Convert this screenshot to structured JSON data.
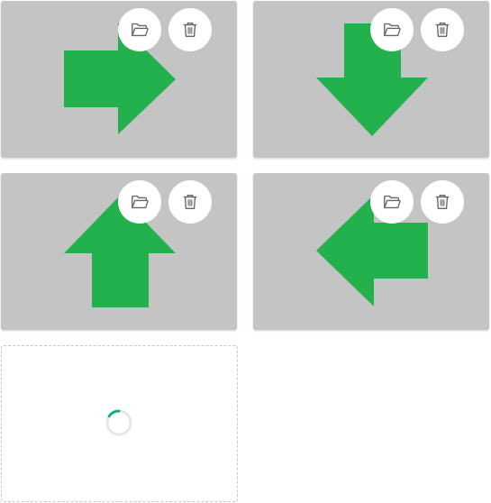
{
  "colors": {
    "tile_background": "#c4c4c4",
    "arrow_green": "#22b14c",
    "button_background": "#ffffff",
    "button_icon": "#666666",
    "spinner_track": "#e6e6e6",
    "spinner_accent": "#1aaa8a"
  },
  "tiles": [
    {
      "arrow": "arrow-right-icon",
      "actions": [
        "folder-open-icon",
        "trash-icon"
      ]
    },
    {
      "arrow": "arrow-down-icon",
      "actions": [
        "folder-open-icon",
        "trash-icon"
      ]
    },
    {
      "arrow": "arrow-up-icon",
      "actions": [
        "folder-open-icon",
        "trash-icon"
      ]
    },
    {
      "arrow": "arrow-left-icon",
      "actions": [
        "folder-open-icon",
        "trash-icon"
      ]
    }
  ],
  "upload_slot": {
    "state": "loading",
    "icon": "spinner-icon"
  }
}
